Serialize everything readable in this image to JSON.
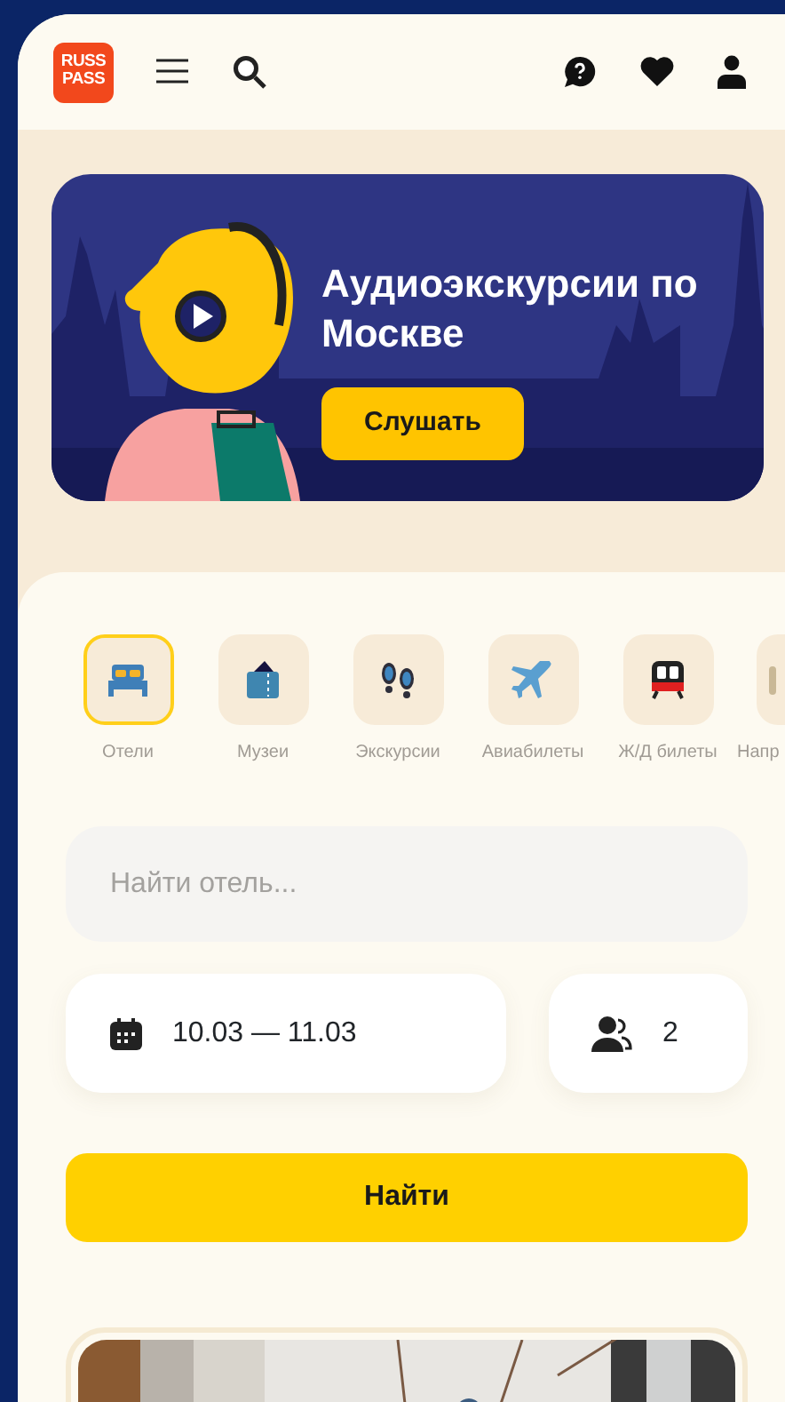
{
  "header": {
    "logo": "RUSS PASS"
  },
  "banner": {
    "title": "Аудиоэкскурсии по Москве",
    "button": "Слушать"
  },
  "categories": [
    {
      "kind": "hotel",
      "label": "Отели",
      "selected": true
    },
    {
      "kind": "museum",
      "label": "Музеи",
      "selected": false
    },
    {
      "kind": "tour",
      "label": "Экскурсии",
      "selected": false
    },
    {
      "kind": "flight",
      "label": "Авиабилеты",
      "selected": false
    },
    {
      "kind": "train",
      "label": "Ж/Д билеты",
      "selected": false
    },
    {
      "kind": "other",
      "label": "Напр",
      "selected": false
    }
  ],
  "search": {
    "placeholder": "Найти отель..."
  },
  "dates": {
    "value": "10.03 — 11.03"
  },
  "guests": {
    "value": "2"
  },
  "submit": "Найти"
}
